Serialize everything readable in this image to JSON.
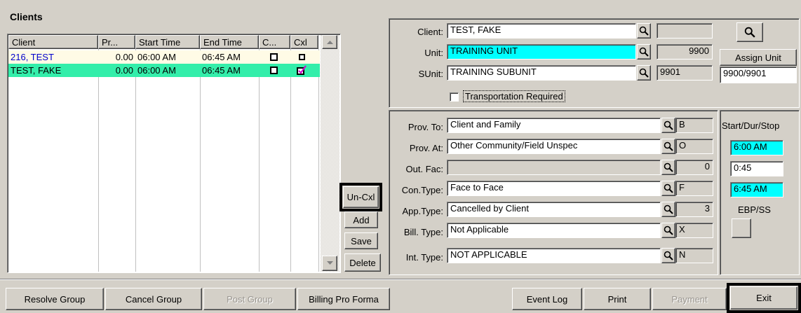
{
  "clients_panel": {
    "title": "Clients",
    "columns": [
      "Client",
      "Pr...",
      "Start Time",
      "End Time",
      "C...",
      "Cxl"
    ],
    "rows": [
      {
        "client": "216, TEST",
        "pr": "0.00",
        "start": "06:00 AM",
        "end": "06:45 AM",
        "c": false,
        "cxl": false
      },
      {
        "client": "TEST, FAKE",
        "pr": "0.00",
        "start": "06:00 AM",
        "end": "06:45 AM",
        "c": false,
        "cxl": true
      }
    ]
  },
  "middle_buttons": {
    "uncxl": "Un-Cxl",
    "add": "Add",
    "save": "Save",
    "delete": "Delete"
  },
  "client_info": {
    "client_label": "Client:",
    "client_value": "TEST, FAKE",
    "client_code": "",
    "unit_label": "Unit:",
    "unit_value": "TRAINING UNIT",
    "unit_code": "9900",
    "sunit_label": "SUnit:",
    "sunit_value": "TRAINING SUBUNIT",
    "sunit_code": "9901",
    "assign_unit_label": "Assign Unit",
    "assign_unit_value": "9900/9901",
    "transportation_label": "Transportation Required",
    "transportation_checked": false
  },
  "service": {
    "prov_to_label": "Prov. To:",
    "prov_to_value": "Client and Family",
    "prov_to_code": "B",
    "prov_at_label": "Prov. At:",
    "prov_at_value": "Other Community/Field Unspec",
    "prov_at_code": "O",
    "out_fac_label": "Out. Fac:",
    "out_fac_value": "",
    "out_fac_code": "0",
    "con_type_label": "Con.Type:",
    "con_type_value": "Face to Face",
    "con_type_code": "F",
    "app_type_label": "App.Type:",
    "app_type_value": "Cancelled by Client",
    "app_type_code": "3",
    "bill_type_label": "Bill. Type:",
    "bill_type_value": "Not Applicable",
    "bill_type_code": "X",
    "int_type_label": "Int. Type:",
    "int_type_value": "NOT APPLICABLE",
    "int_type_code": "N"
  },
  "timing": {
    "label": "Start/Dur/Stop",
    "start": "6:00 AM",
    "duration": "0:45",
    "stop": "6:45 AM",
    "ebp_label": "EBP/SS"
  },
  "bottom_bar": {
    "resolve_group": "Resolve Group",
    "cancel_group": "Cancel Group",
    "post_group": "Post Group",
    "billing_pro_forma": "Billing Pro Forma",
    "event_log": "Event Log",
    "print": "Print",
    "payment": "Payment",
    "exit": "Exit"
  },
  "colors": {
    "window_bg": "#d4d0c8",
    "row1_bg": "#fffbe6",
    "row_selected_bg": "#33eeaa",
    "cyan_field": "#00ffff",
    "link_blue": "#0000cc",
    "checkmark": "#cc00cc"
  }
}
